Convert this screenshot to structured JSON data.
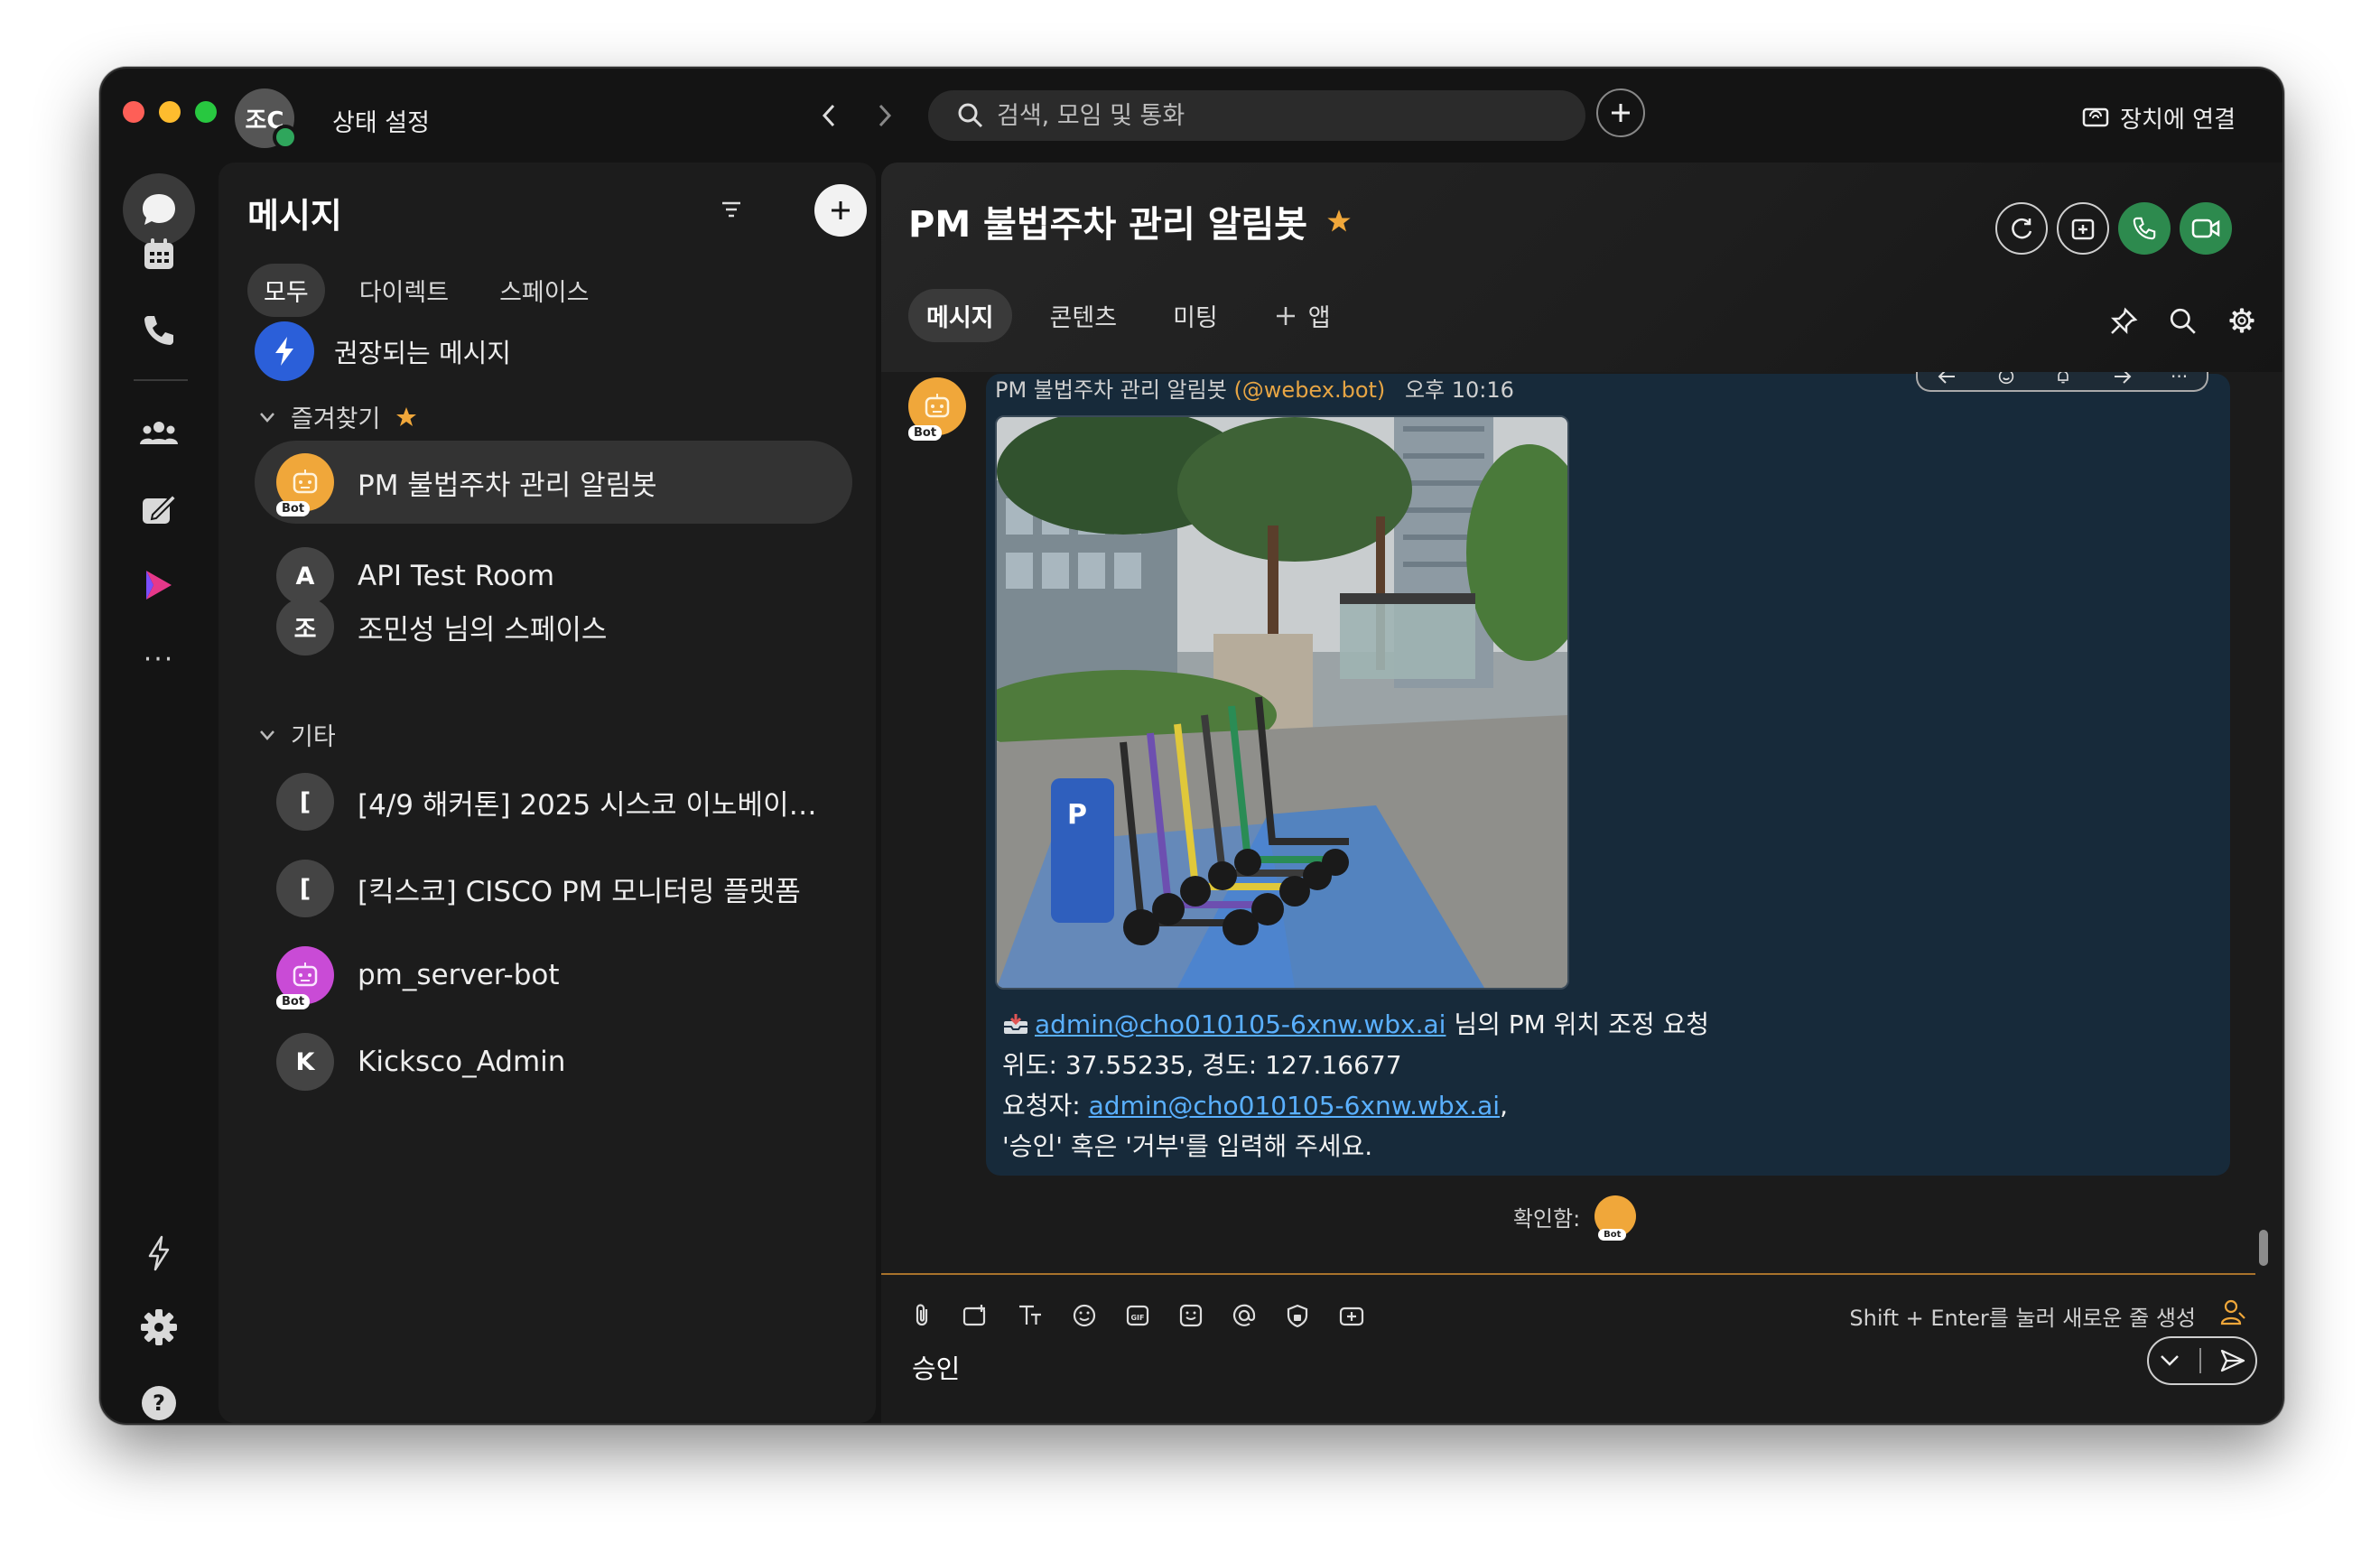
{
  "titlebar": {
    "user_initials": "조C",
    "status_label": "상태 설정",
    "search_placeholder": "검색, 모임 및 통화",
    "connect_device": "장치에 연결"
  },
  "rail": {
    "items": [
      "messaging-icon",
      "calendar-icon",
      "calls-icon",
      "teams-icon",
      "whiteboard-icon",
      "webex-app-icon",
      "more-icon"
    ],
    "bottom": [
      "bolt-icon",
      "settings-icon",
      "help-icon"
    ]
  },
  "panel": {
    "title": "메시지",
    "tabs": [
      "모두",
      "다이렉트",
      "스페이스"
    ],
    "recommended": "권장되는 메시지",
    "favorites_label": "즐겨찾기",
    "others_label": "기타",
    "favorites": [
      {
        "name": "PM 불법주차 관리 알림봇",
        "initial": "",
        "bot": "Bot"
      },
      {
        "name": "API Test Room",
        "initial": "A"
      },
      {
        "name": "조민성 님의 스페이스",
        "initial": "조"
      }
    ],
    "others": [
      {
        "name": "[4/9 해커톤] 2025 시스코 이노베이션…",
        "initial": "["
      },
      {
        "name": "[킥스코] CISCO PM 모니터링 플랫폼",
        "initial": "["
      },
      {
        "name": "pm_server-bot",
        "initial": "",
        "bot": "Bot"
      },
      {
        "name": "Kicksco_Admin",
        "initial": "K"
      }
    ]
  },
  "conversation": {
    "title": "PM 불법주차 관리 알림봇",
    "tabs": [
      "메시지",
      "콘텐츠",
      "미팅",
      "앱"
    ],
    "message": {
      "sender": "PM 불법주차 관리 알림봇",
      "handle": "(@webex.bot)",
      "time": "오후 10:16",
      "avatar_tag": "Bot",
      "line1_link": "admin@cho010105-6xnw.wbx.ai",
      "line1_rest": " 님의 PM 위치 조정 요청",
      "line2": "위도: 37.55235, 경도: 127.16677",
      "line3_prefix": "요청자: ",
      "line3_link": "admin@cho010105-6xnw.wbx.ai",
      "line3_suffix": ",",
      "line4": "'승인' 혹은 '거부'를 입력해 주세요."
    },
    "read_by_label": "확인함:",
    "read_by_tag": "Bot",
    "composer_hint": "Shift + Enter를 눌러 새로운 줄 생성",
    "composer_value": "승인"
  },
  "colors": {
    "accent_orange": "#f0a73a",
    "link": "#5ab0ff",
    "bubble": "#172a3a",
    "call_green": "#2d8a4e"
  }
}
